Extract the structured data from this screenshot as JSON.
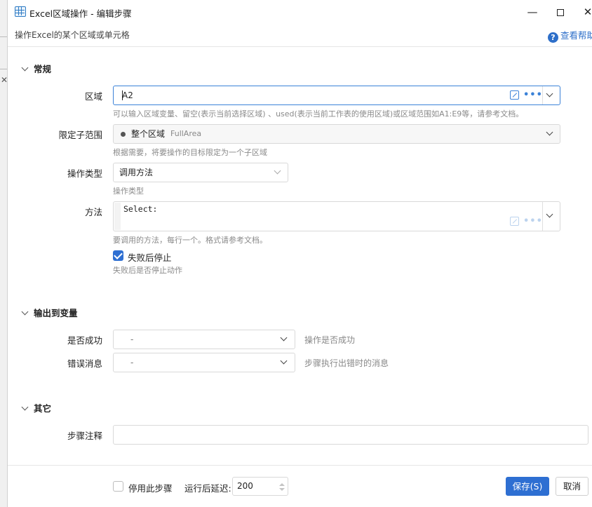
{
  "window": {
    "title": "Excel区域操作  -  编辑步骤",
    "subtitle": "操作Excel的某个区域或单元格",
    "help_label": "查看帮助"
  },
  "sections": {
    "general": "常规",
    "output": "输出到变量",
    "other": "其它"
  },
  "fields": {
    "range": {
      "label": "区域",
      "value": "A2",
      "hint": "可以输入区域变量、留空(表示当前选择区域) 、used(表示当前工作表的使用区域)或区域范围如A1:E9等，请参考文档。"
    },
    "subrange": {
      "label": "限定子范围",
      "value": "整个区域",
      "value_en": "FullArea",
      "hint": "根据需要，将要操作的目标限定为一个子区域"
    },
    "op_type": {
      "label": "操作类型",
      "value": "调用方法",
      "hint": "操作类型"
    },
    "method": {
      "label": "方法",
      "value": "Select:",
      "hint": "要调用的方法，每行一个。格式请参考文档。"
    },
    "stop_on_fail": {
      "label": "失败后停止",
      "checked": true,
      "hint": "失败后是否停止动作"
    },
    "success": {
      "label": "是否成功",
      "value": "-",
      "side_hint": "操作是否成功"
    },
    "error_msg": {
      "label": "错误消息",
      "value": "-",
      "side_hint": "步骤执行出错时的消息"
    },
    "comment": {
      "label": "步骤注释",
      "value": ""
    }
  },
  "footer": {
    "disable_label": "停用此步骤",
    "delay_label": "运行后延迟:",
    "delay_value": "200",
    "save_label": "保存(S)",
    "cancel_label": "取消"
  }
}
